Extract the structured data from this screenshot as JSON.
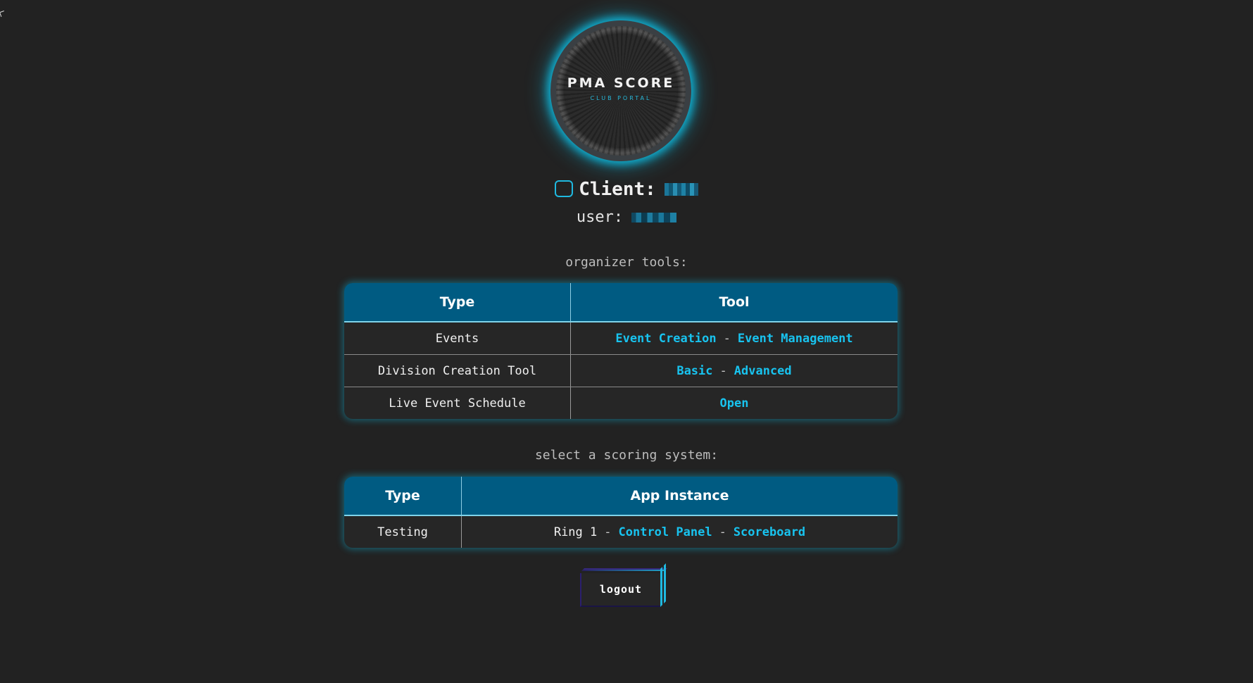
{
  "logo": {
    "title": "PMA SCORE",
    "subtitle": "CLUB PORTAL"
  },
  "client": {
    "label": "Client:"
  },
  "user": {
    "label": "user:"
  },
  "organizer_tools": {
    "heading": "organizer tools:",
    "headers": [
      "Type",
      "Tool"
    ],
    "rows": [
      {
        "type": "Events",
        "links": [
          "Event Creation",
          "Event Management"
        ]
      },
      {
        "type": "Division Creation Tool",
        "links": [
          "Basic",
          "Advanced"
        ]
      },
      {
        "type": "Live Event Schedule",
        "links": [
          "Open"
        ]
      }
    ],
    "separator": "-"
  },
  "scoring": {
    "heading": "select a scoring system:",
    "headers": [
      "Type",
      "App Instance"
    ],
    "rows": [
      {
        "type": "Testing",
        "prefix": "Ring 1",
        "links": [
          "Control Panel",
          "Scoreboard"
        ]
      }
    ],
    "separator": "-"
  },
  "logout": {
    "label": "logout"
  },
  "colors": {
    "background": "#222222",
    "accent": "#18c3ef",
    "header_bg": "#005b82"
  }
}
